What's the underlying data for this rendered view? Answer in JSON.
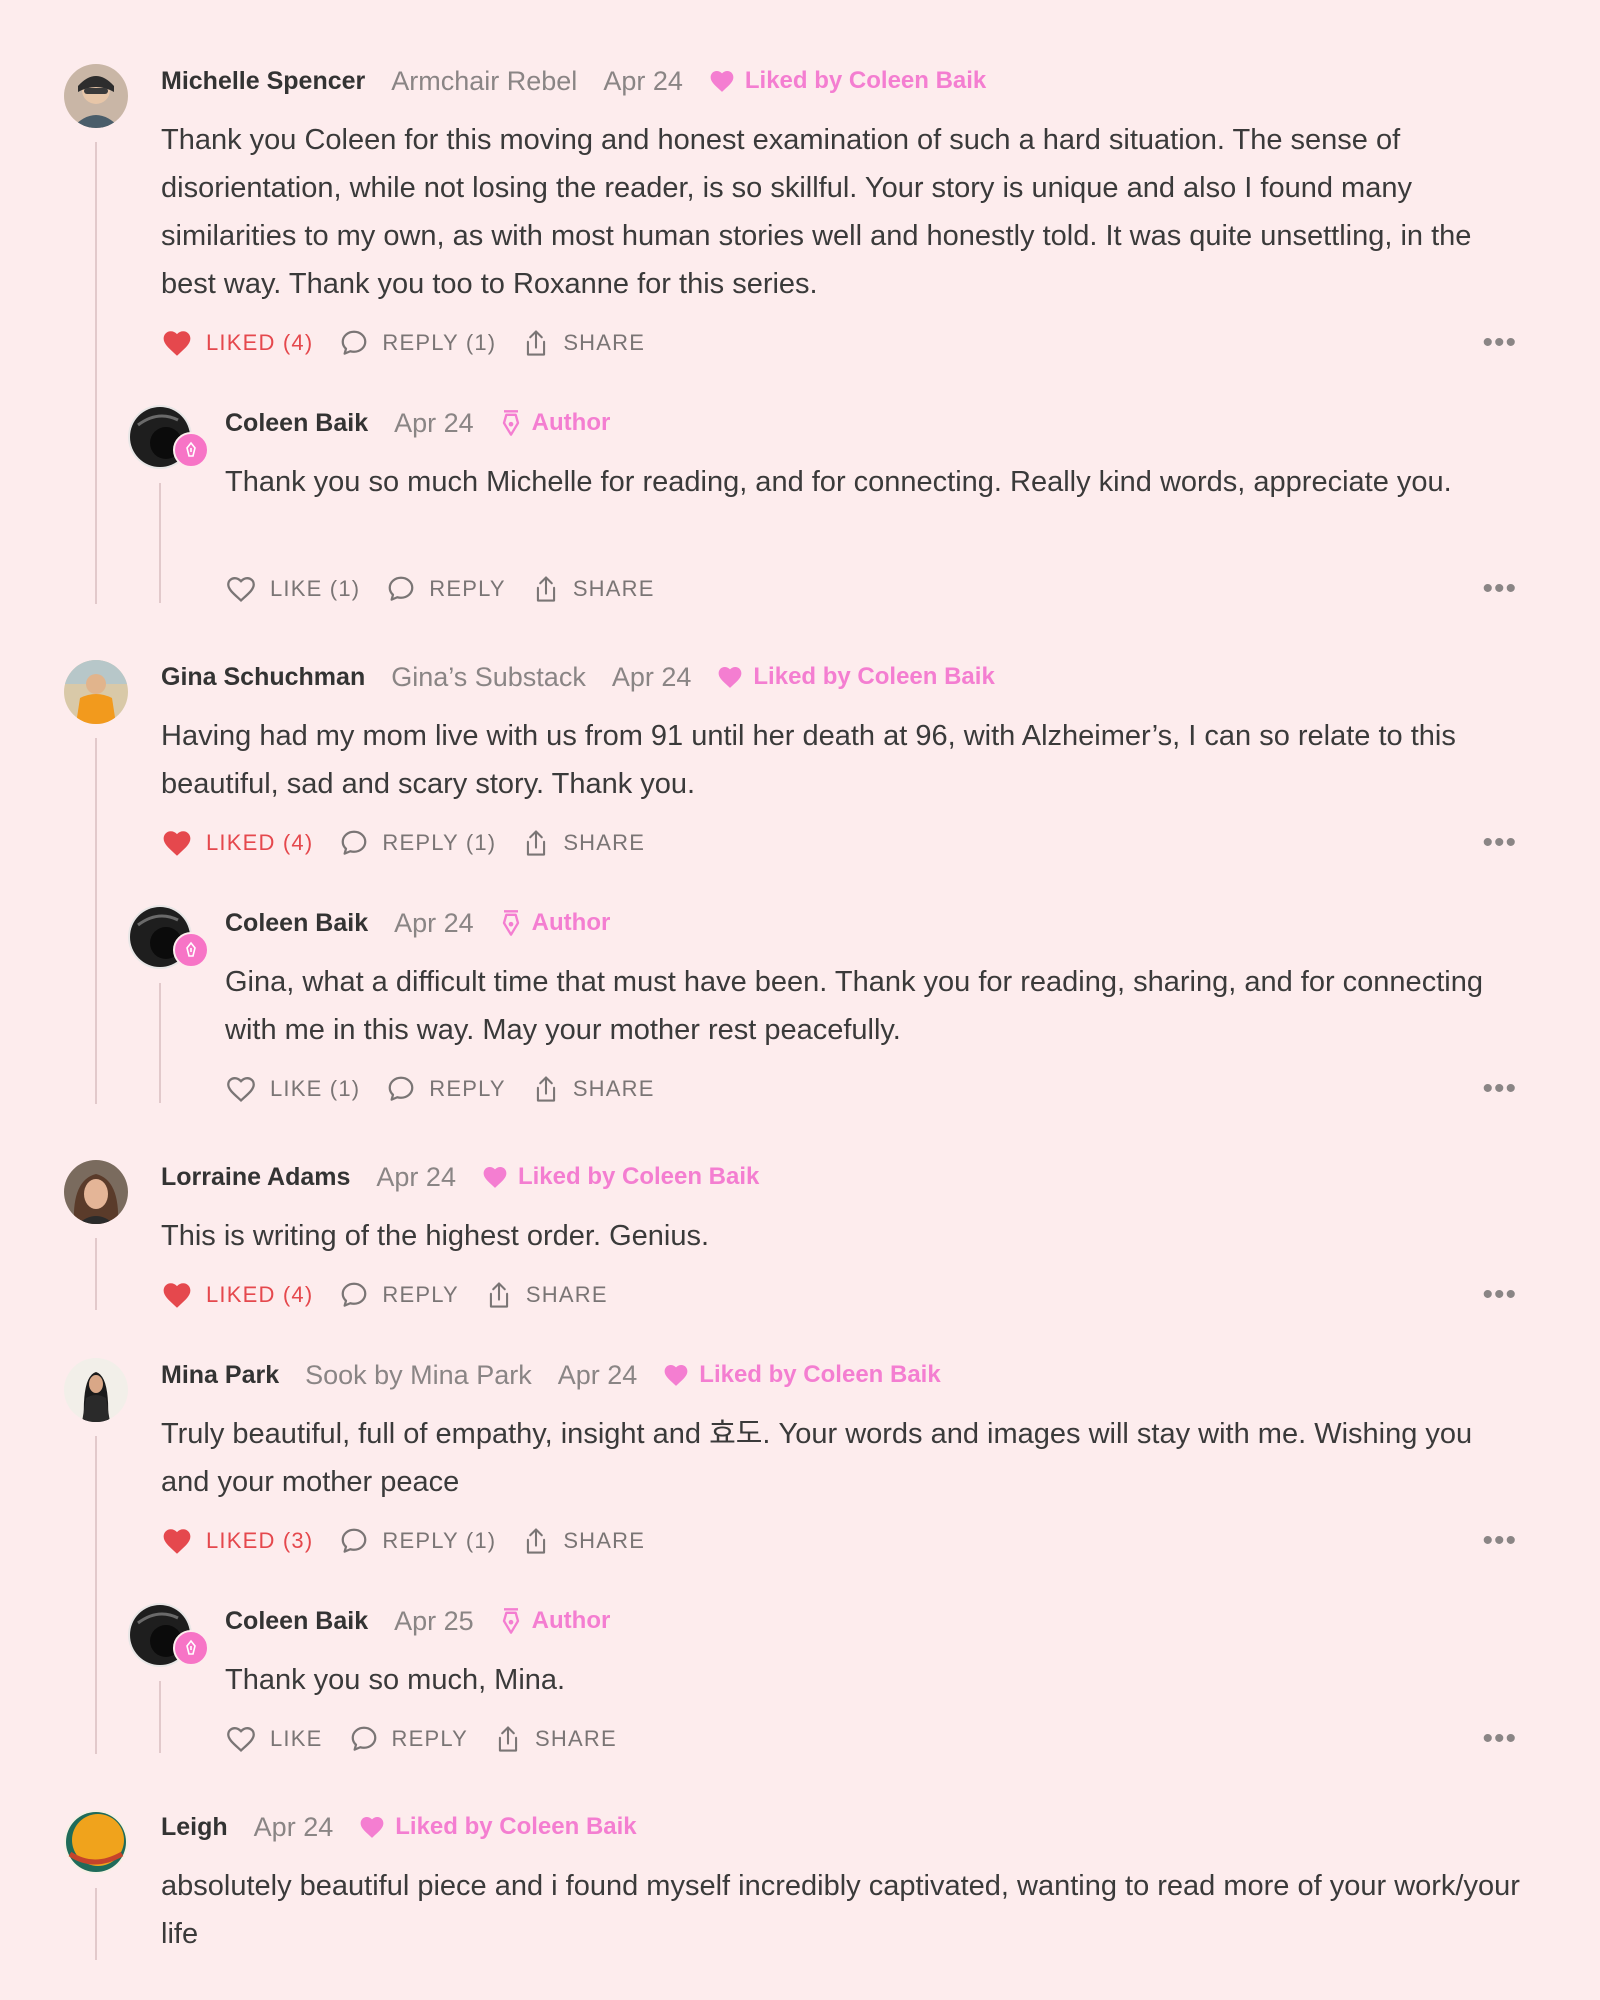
{
  "labels": {
    "liked": "LIKED",
    "like": "LIKE",
    "reply": "REPLY",
    "share": "SHARE",
    "author": "Author",
    "more": "•••"
  },
  "colors": {
    "background": "#fdeced",
    "liked_red": "#e5484d",
    "pink_badge": "#f47ed1",
    "thread_line": "#e2c9cb"
  },
  "comments": [
    {
      "name": "Michelle Spencer",
      "publication": "Armchair Rebel",
      "date": "Apr 24",
      "badge": "Liked by Coleen Baik",
      "text": "Thank you Coleen for this moving and honest examination of such a hard situation. The sense of disorientation, while not losing the reader, is so skillful. Your story is unique and also I found many similarities to my own, as with most human stories well and honestly told. It was quite unsettling, in the best way. Thank you too to Roxanne for this series.",
      "like_label": "LIKED (4)",
      "reply_label": "REPLY (1)",
      "share_label": "SHARE",
      "liked": true,
      "avatar_icon": "user-photo-icon"
    },
    {
      "name": "Coleen Baik",
      "date": "Apr 24",
      "badge": "Author",
      "text": "Thank you so much Michelle for reading, and for connecting. Really kind words, appreciate you.",
      "like_label": "LIKE (1)",
      "reply_label": "REPLY",
      "share_label": "SHARE",
      "liked": false
    },
    {
      "name": "Gina Schuchman",
      "publication": "Gina’s Substack",
      "date": "Apr 24",
      "badge": "Liked by Coleen Baik",
      "text": "Having had my mom live with us from 91 until her death at 96, with Alzheimer’s, I can so relate to this beautiful, sad and scary story. Thank you.",
      "like_label": "LIKED (4)",
      "reply_label": "REPLY (1)",
      "share_label": "SHARE",
      "liked": true
    },
    {
      "name": "Coleen Baik",
      "date": "Apr 24",
      "badge": "Author",
      "text": "Gina, what a difficult time that must have been. Thank you for reading, sharing, and for connecting with me in this way. May your mother rest peacefully.",
      "like_label": "LIKE (1)",
      "reply_label": "REPLY",
      "share_label": "SHARE",
      "liked": false
    },
    {
      "name": "Lorraine Adams",
      "date": "Apr 24",
      "badge": "Liked by Coleen Baik",
      "text": "This is writing of the highest order. Genius.",
      "like_label": "LIKED (4)",
      "reply_label": "REPLY",
      "share_label": "SHARE",
      "liked": true
    },
    {
      "name": "Mina Park",
      "publication": "Sook by Mina Park",
      "date": "Apr 24",
      "badge": "Liked by Coleen Baik",
      "text": "Truly beautiful, full of empathy, insight and 효도. Your words and images will stay with me. Wishing you and your mother peace",
      "like_label": "LIKED (3)",
      "reply_label": "REPLY (1)",
      "share_label": "SHARE",
      "liked": true
    },
    {
      "name": "Coleen Baik",
      "date": "Apr 25",
      "badge": "Author",
      "text": "Thank you so much, Mina.",
      "like_label": "LIKE",
      "reply_label": "REPLY",
      "share_label": "SHARE",
      "liked": false
    },
    {
      "name": "Leigh",
      "date": "Apr 24",
      "badge": "Liked by Coleen Baik",
      "text": "absolutely beautiful piece and i found myself incredibly captivated, wanting to read more of your work/your life"
    }
  ]
}
